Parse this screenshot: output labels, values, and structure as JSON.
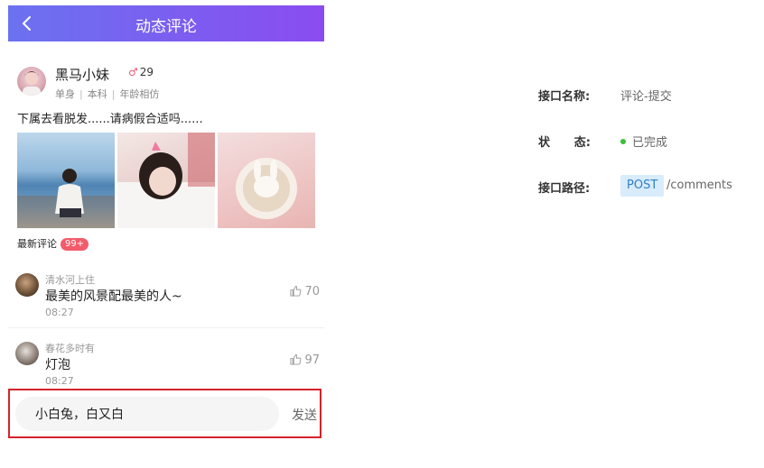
{
  "nav": {
    "title": "动态评论",
    "back_icon": "chevron-left-icon"
  },
  "post": {
    "author": "黑马小妹",
    "gender_icon": "male-symbol-icon",
    "age": "29",
    "tags": [
      "单身",
      "本科",
      "年龄相仿"
    ],
    "text": "下属去看脱发......请病假合适吗......",
    "images": [
      "photo-girl-seaside",
      "photo-girl-lying",
      "photo-latte-art"
    ]
  },
  "latest": {
    "label": "最新评论",
    "badge": "99+"
  },
  "comments": [
    {
      "name": "清水河上住",
      "text": "最美的风景配最美的人~",
      "time": "08:27",
      "likes": "70"
    },
    {
      "name": "春花多时有",
      "text": "灯泡",
      "time": "08:27",
      "likes": "97"
    }
  ],
  "input": {
    "value": "小白兔，白又白",
    "send_label": "发送"
  },
  "api": {
    "name_label": "接口名称:",
    "name_value": "评论-提交",
    "status_label_a": "状",
    "status_label_b": "态:",
    "status_value": "已完成",
    "status_color": "#3bbf3b",
    "path_label": "接口路径:",
    "method": "POST",
    "path": "/comments"
  },
  "colors": {
    "nav_start": "#6b72f0",
    "nav_end": "#8a4cf0",
    "badge": "#f25c6a",
    "highlight_border": "#d5232b"
  }
}
